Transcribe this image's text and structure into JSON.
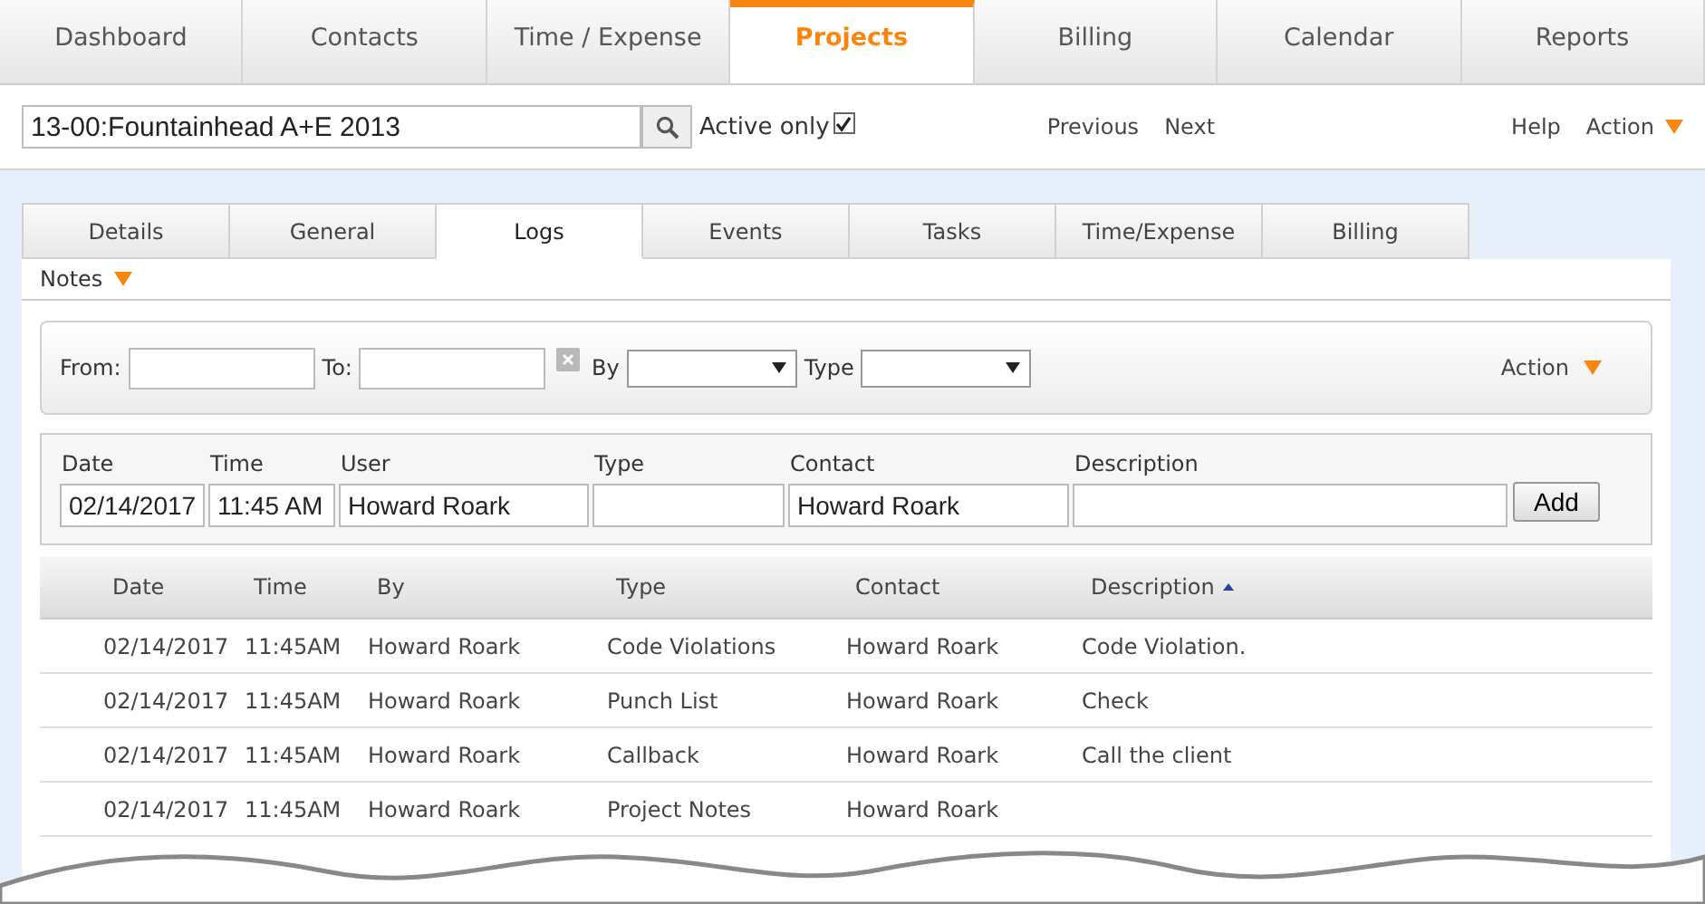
{
  "main_tabs": [
    {
      "label": "Dashboard",
      "selected": false
    },
    {
      "label": "Contacts",
      "selected": false
    },
    {
      "label": "Time / Expense",
      "selected": false
    },
    {
      "label": "Projects",
      "selected": true
    },
    {
      "label": "Billing",
      "selected": false
    },
    {
      "label": "Calendar",
      "selected": false
    },
    {
      "label": "Reports",
      "selected": false
    }
  ],
  "toolbar": {
    "project": "13-00:Fountainhead A+E 2013",
    "active_only": {
      "label": "Active only",
      "checked": true
    },
    "previous": "Previous",
    "next": "Next",
    "help": "Help",
    "action": "Action"
  },
  "sub_tabs": [
    {
      "label": "Details",
      "selected": false
    },
    {
      "label": "General",
      "selected": false
    },
    {
      "label": "Logs",
      "selected": true
    },
    {
      "label": "Events",
      "selected": false
    },
    {
      "label": "Tasks",
      "selected": false
    },
    {
      "label": "Time/Expense",
      "selected": false
    },
    {
      "label": "Billing",
      "selected": false
    }
  ],
  "notes_menu": "Notes",
  "filter": {
    "from_label": "From:",
    "to_label": "To:",
    "by_label": "By",
    "type_label": "Type",
    "action": "Action"
  },
  "entry": {
    "fields": [
      {
        "label": "Date",
        "value": "02/14/2017"
      },
      {
        "label": "Time",
        "value": "11:45 AM"
      },
      {
        "label": "User",
        "value": "Howard Roark"
      },
      {
        "label": "Type"
      },
      {
        "label": "Contact",
        "value": "Howard Roark"
      },
      {
        "label": "Description"
      }
    ],
    "add": "Add"
  },
  "table": {
    "columns": [
      {
        "label": "Date",
        "sorted": false
      },
      {
        "label": "Time",
        "sorted": false
      },
      {
        "label": "By",
        "sorted": false
      },
      {
        "label": "Type",
        "sorted": false
      },
      {
        "label": "Contact",
        "sorted": false
      },
      {
        "label": "Description",
        "sorted": true
      }
    ],
    "rows": [
      [
        "02/14/2017",
        "11:45AM",
        "Howard Roark",
        "Code Violations",
        "Howard Roark",
        "Code Violation."
      ],
      [
        "02/14/2017",
        "11:45AM",
        "Howard Roark",
        "Punch List",
        "Howard Roark",
        "Check"
      ],
      [
        "02/14/2017",
        "11:45AM",
        "Howard Roark",
        "Callback",
        "Howard Roark",
        "Call the client"
      ],
      [
        "02/14/2017",
        "11:45AM",
        "Howard Roark",
        "Project Notes",
        "Howard Roark",
        ""
      ]
    ]
  }
}
